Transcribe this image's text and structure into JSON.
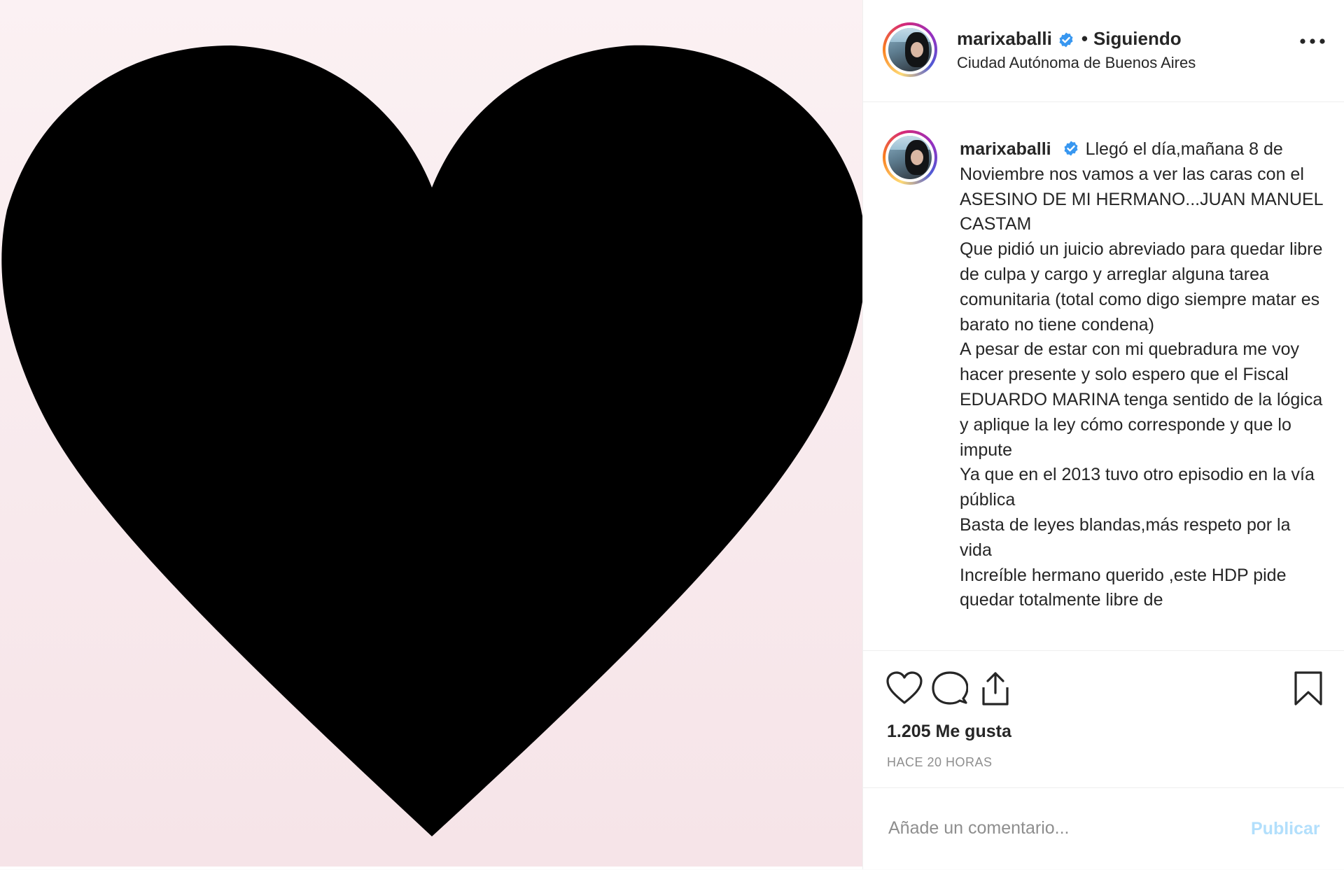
{
  "header": {
    "username": "marixaballi",
    "separator": "•",
    "follow_status": "Siguiendo",
    "location": "Ciudad Autónoma de Buenos Aires",
    "more_icon": "more-horizontal-icon"
  },
  "caption": {
    "username": "marixaballi",
    "text": "Llegó el día,mañana 8 de Noviembre nos vamos a ver las caras con el ASESINO DE MI HERMANO...JUAN MANUEL CASTAM\nQue pidió un juicio abreviado para quedar libre de culpa y cargo y arreglar alguna tarea comunitaria (total como digo siempre matar es barato no tiene condena)\nA pesar de estar con mi quebradura me voy hacer presente y solo espero que el Fiscal EDUARDO MARINA tenga sentido de la lógica y aplique la ley cómo corresponde y que lo impute\nYa que en el 2013 tuvo otro episodio en la vía pública\nBasta de leyes blandas,más respeto por la vida\nIncreíble hermano querido ,este HDP pide quedar totalmente libre de"
  },
  "actions": {
    "like_icon": "heart-icon",
    "comment_icon": "comment-icon",
    "share_icon": "share-icon",
    "save_icon": "bookmark-icon"
  },
  "likes": "1.205 Me gusta",
  "timestamp": "HACE 20 HORAS",
  "comment": {
    "placeholder": "Añade un comentario...",
    "publish_label": "Publicar"
  },
  "media": {
    "description_icon": "black-heart-image"
  },
  "colors": {
    "verified": "#3897f0",
    "publish_disabled": "#b2dffc",
    "muted": "#8e8e8e",
    "heart": "#000000",
    "media_bg": "#f8eaee"
  }
}
